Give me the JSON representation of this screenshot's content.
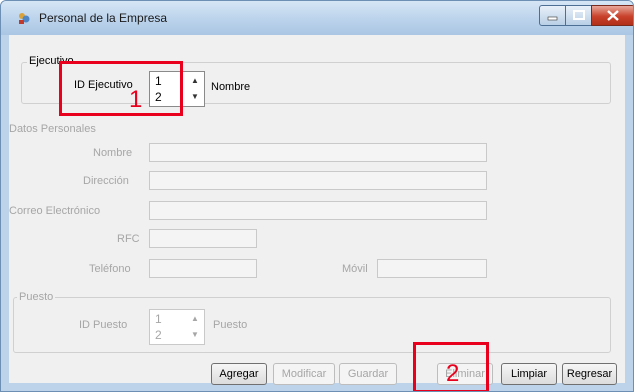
{
  "window": {
    "title": "Personal de la Empresa"
  },
  "colors": {
    "annotation": "#e8001c",
    "title_gradient_top": "#d6e6f6",
    "disabled_text": "#a6a6a6"
  },
  "ejecutivo": {
    "group_label": "Ejecutivo",
    "id_label": "ID Ejecutivo",
    "id_values": [
      "1",
      "2"
    ],
    "nombre_label": "Nombre"
  },
  "datos": {
    "group_label": "Datos Personales",
    "nombre_label": "Nombre",
    "direccion_label": "Dirección",
    "correo_label": "Correo Electrónico",
    "rfc_label": "RFC",
    "telefono_label": "Teléfono",
    "movil_label": "Móvil"
  },
  "puesto": {
    "group_label": "Puesto",
    "id_label": "ID Puesto",
    "id_values": [
      "1",
      "2"
    ],
    "puesto_label": "Puesto"
  },
  "buttons": {
    "agregar": "Agregar",
    "modificar": "Modificar",
    "guardar": "Guardar",
    "eliminar": "Eliminar",
    "limpiar": "Limpiar",
    "regresar": "Regresar"
  },
  "annotations": {
    "one": "1",
    "two": "2"
  }
}
